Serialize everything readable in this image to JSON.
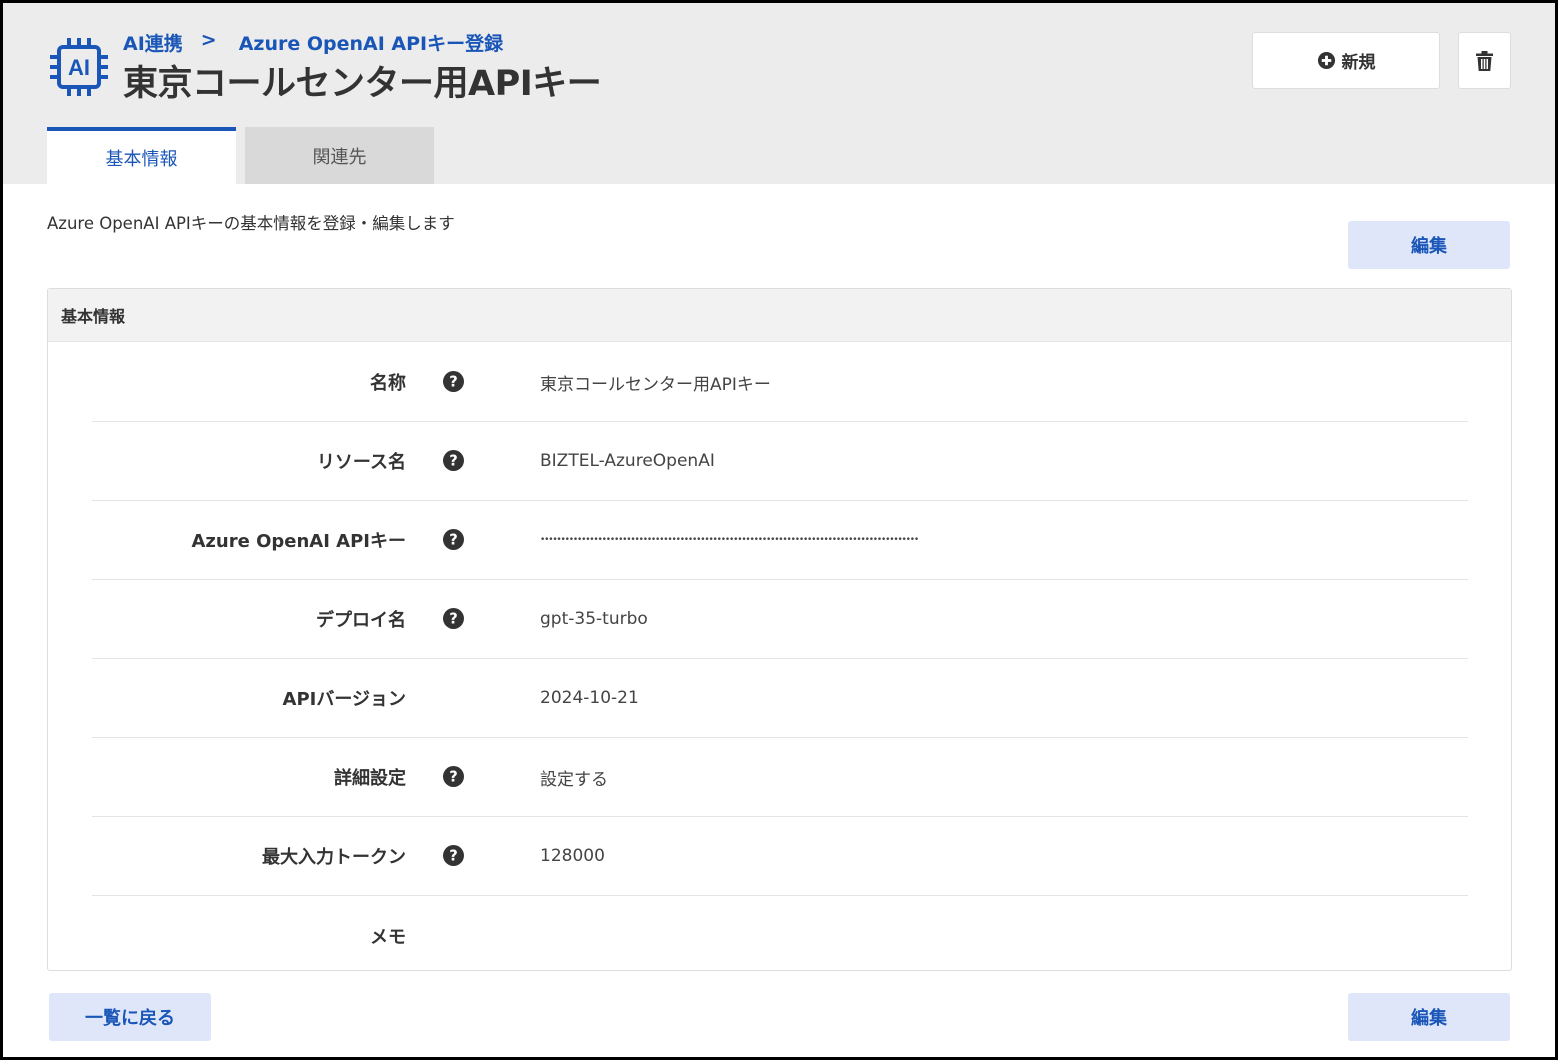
{
  "breadcrumb": {
    "parent": "AI連携",
    "separator": ">",
    "current": "Azure OpenAI APIキー登録"
  },
  "page_title": "東京コールセンター用APIキー",
  "logo_text": "AI",
  "actions": {
    "new_label": "新規"
  },
  "tabs": [
    {
      "label": "基本情報"
    },
    {
      "label": "関連先"
    }
  ],
  "description": "Azure OpenAI APIキーの基本情報を登録・編集します",
  "edit_label": "編集",
  "back_label": "一覧に戻る",
  "panel": {
    "title": "基本情報",
    "fields": [
      {
        "label": "名称",
        "value": "東京コールセンター用APIキー"
      },
      {
        "label": "リソース名",
        "value": "BIZTEL-AzureOpenAI"
      },
      {
        "label": "Azure OpenAI APIキー",
        "value": "••••••••••••••••••••••••••••••••••••••••••••••••••••••••••••••••••••••••••••••••••••••••••••"
      },
      {
        "label": "デプロイ名",
        "value": "gpt-35-turbo"
      },
      {
        "label": "APIバージョン",
        "value": "2024-10-21"
      },
      {
        "label": "詳細設定",
        "value": "設定する"
      },
      {
        "label": "最大入力トークン",
        "value": "128000"
      },
      {
        "label": "メモ",
        "value": ""
      }
    ]
  },
  "colors": {
    "accent": "#1a56b8",
    "header_bg": "#ececec",
    "button_bg": "#dfe6fa"
  },
  "icons": {
    "logo": "ai-chip-icon",
    "new": "plus-circle-icon",
    "delete": "trash-icon",
    "help": "question-circle-icon"
  }
}
